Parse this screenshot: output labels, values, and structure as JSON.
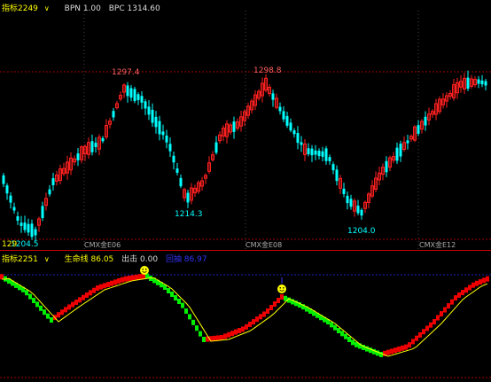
{
  "top": {
    "indicator": "指标2249",
    "bpn": "BPN 1.00",
    "bpc": "BPC 1314.60",
    "price_labels": [
      {
        "text": "1297.4",
        "type": "high"
      },
      {
        "text": "1298.8",
        "type": "high"
      },
      {
        "text": "1214.3",
        "type": "low"
      },
      {
        "text": "1204.0",
        "type": "low"
      },
      {
        "text": "1204.5",
        "type": "low"
      }
    ],
    "left_edge_label": "129",
    "axis_labels": [
      "CMX金E06",
      "CMX金E08",
      "CMX金E12"
    ]
  },
  "bottom": {
    "indicator": "指标2251",
    "life_line": "生命线 86.05",
    "exit": "出击 0.00",
    "dive": "回抽 86.97"
  },
  "colors": {
    "up": "#ff2020",
    "down": "#00ffff",
    "red_dotted": "#a00000",
    "blue_dotted": "#2020c0",
    "life_line": "#ffff00",
    "bar_green": "#00ee00",
    "bar_red": "#ee0000",
    "smile": "#ffff00"
  }
}
